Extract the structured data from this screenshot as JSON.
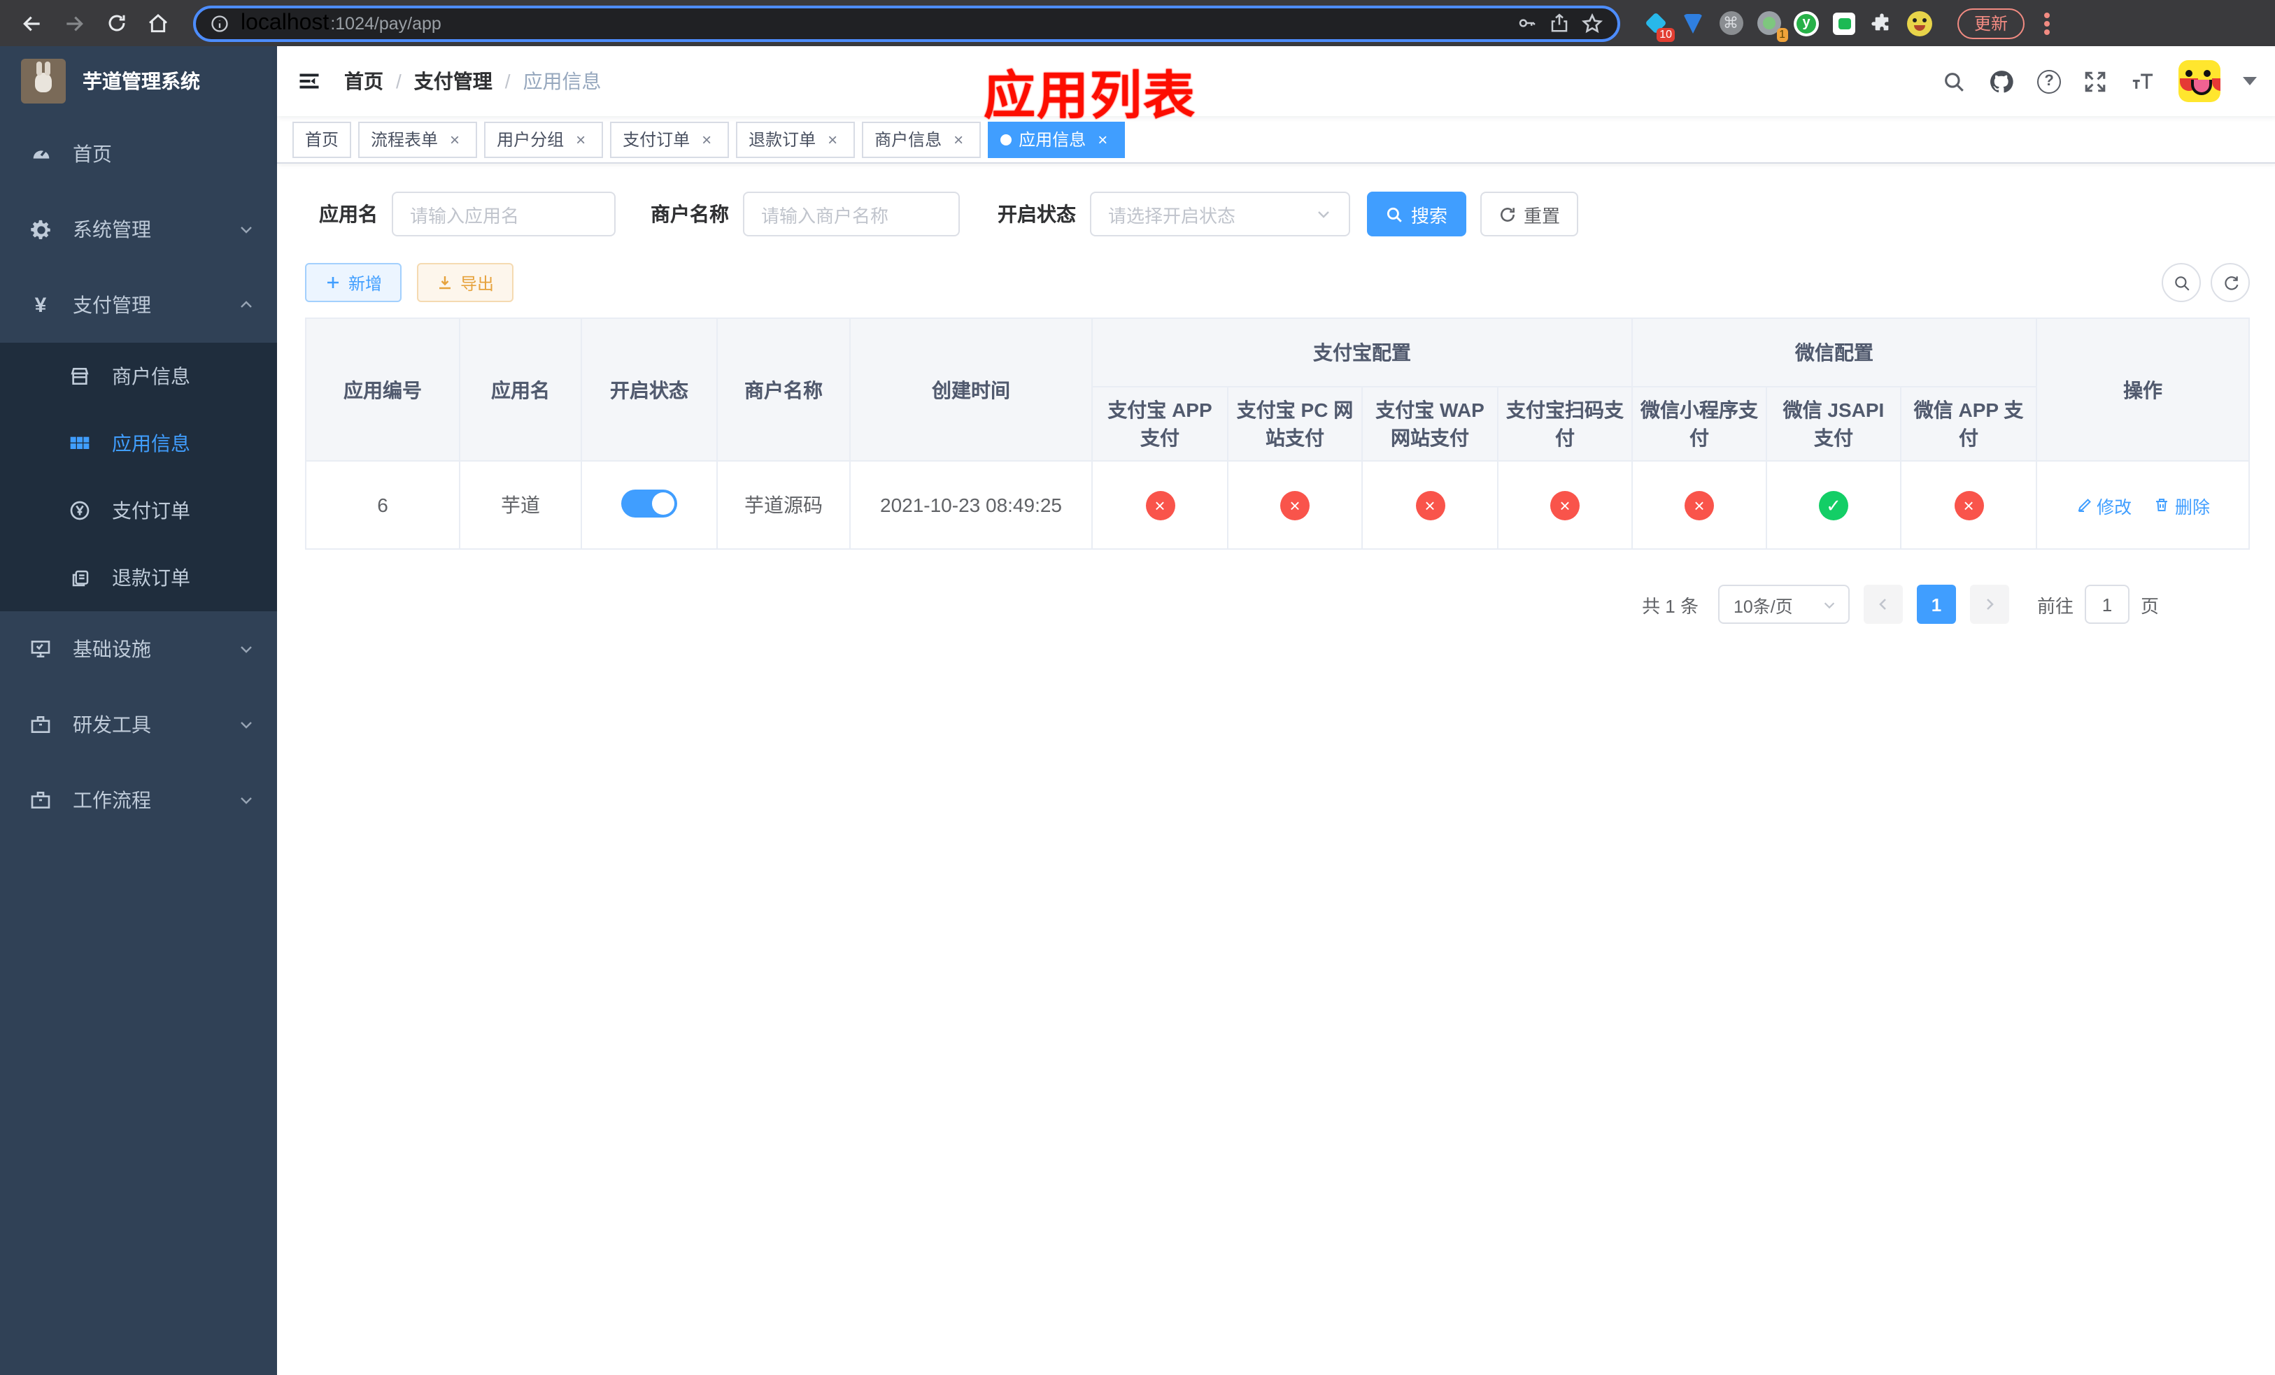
{
  "browser": {
    "url_host": "localhost",
    "url_rest": ":1024/pay/app",
    "update_label": "更新",
    "ext_pin_badge": "10",
    "ext_one_badge": "1",
    "ext_cmd_glyph": "⌘",
    "ext_y_glyph": "y"
  },
  "sidebar": {
    "app_title": "芋道管理系统",
    "yen_glyph": "¥",
    "items": [
      {
        "label": "首页"
      },
      {
        "label": "系统管理"
      },
      {
        "label": "支付管理"
      },
      {
        "label": "商户信息"
      },
      {
        "label": "应用信息"
      },
      {
        "label": "支付订单"
      },
      {
        "label": "退款订单"
      },
      {
        "label": "基础设施"
      },
      {
        "label": "研发工具"
      },
      {
        "label": "工作流程"
      }
    ]
  },
  "navbar": {
    "breadcrumb": {
      "home": "首页",
      "section": "支付管理",
      "current": "应用信息",
      "separator": "/"
    },
    "annotation": "应用列表"
  },
  "tabs": [
    {
      "label": "首页"
    },
    {
      "label": "流程表单"
    },
    {
      "label": "用户分组"
    },
    {
      "label": "支付订单"
    },
    {
      "label": "退款订单"
    },
    {
      "label": "商户信息"
    },
    {
      "label": "应用信息"
    }
  ],
  "ui": {
    "close_glyph": "×"
  },
  "filters": {
    "app_name_label": "应用名",
    "app_name_placeholder": "请输入应用名",
    "merchant_label": "商户名称",
    "merchant_placeholder": "请输入商户名称",
    "status_label": "开启状态",
    "status_placeholder": "请选择开启状态",
    "search_label": "搜索",
    "reset_label": "重置"
  },
  "toolbar": {
    "add_label": "新增",
    "export_label": "导出"
  },
  "table": {
    "headers": {
      "app_id": "应用编号",
      "app_name": "应用名",
      "open_status": "开启状态",
      "merchant_name": "商户名称",
      "create_time": "创建时间",
      "alipay_group": "支付宝配置",
      "alipay_cols": [
        "支付宝 APP 支付",
        "支付宝 PC 网站支付",
        "支付宝 WAP 网站支付",
        "支付宝扫码支付"
      ],
      "wechat_group": "微信配置",
      "wechat_cols": [
        "微信小程序支付",
        "微信 JSAPI 支付",
        "微信 APP 支付"
      ],
      "actions": "操作"
    },
    "row": {
      "app_id": "6",
      "app_name": "芋道",
      "toggle_class": "switch on",
      "merchant_name": "芋道源码",
      "create_time": "2021-10-23 08:49:25",
      "status_glyphs": [
        "×",
        "×",
        "×",
        "×",
        "×",
        "✓",
        "×"
      ],
      "status_classes": [
        "cell-dot danger",
        "cell-dot danger",
        "cell-dot danger",
        "cell-dot danger",
        "cell-dot danger",
        "cell-dot success",
        "cell-dot danger"
      ],
      "edit_label": "修改",
      "delete_label": "删除"
    }
  },
  "pagination": {
    "total_text": "共 1 条",
    "page_size": "10条/页",
    "current_page": "1",
    "goto_label": "前往",
    "goto_value": "1",
    "page_suffix": "页"
  },
  "colors": {
    "primary": "#409eff",
    "danger": "#f9544b",
    "success": "#13ce66",
    "warning": "#e6a23c",
    "sidebar": "#304156",
    "annotation": "#fd0d00"
  }
}
